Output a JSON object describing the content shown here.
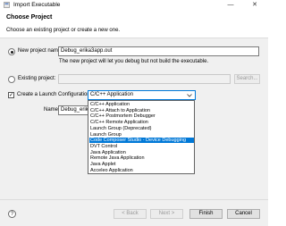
{
  "window": {
    "title": "Import Executable",
    "minimize_glyph": "—",
    "close_glyph": "✕"
  },
  "header": {
    "title": "Choose Project",
    "description": "Choose an existing project or create a new one."
  },
  "new_project": {
    "label": "New project name:",
    "value": "Debug_erika3app.out",
    "hint": "The new project will let you debug but not build the executable."
  },
  "existing_project": {
    "label": "Existing project:",
    "value": "",
    "browse_label": "Search..."
  },
  "launch": {
    "checkbox_label": "Create a Launch Configuration:",
    "checked_glyph": "✓",
    "selected": "C/C++ Application",
    "name_label": "Name:",
    "name_value": "Debug_erika",
    "options": [
      "C/C++ Application",
      "C/C++ Attach to Application",
      "C/C++ Postmortem Debugger",
      "C/C++ Remote Application",
      "Launch Group (Deprecated)",
      "Launch Group",
      "Code Composer Studio - Device Debugging",
      "DVT Control",
      "Java Application",
      "Remote Java Application",
      "Java Applet",
      "Acceleo Application"
    ],
    "highlighted_index": 6
  },
  "footer": {
    "help_glyph": "?",
    "back_label": "< Back",
    "next_label": "Next >",
    "finish_label": "Finish",
    "cancel_label": "Cancel"
  },
  "colors": {
    "accent": "#0078d7",
    "background": "#f0f0f0"
  },
  "icons": {
    "app": "app-icon",
    "help": "help-icon",
    "dropdown": "chevron-down-icon"
  }
}
